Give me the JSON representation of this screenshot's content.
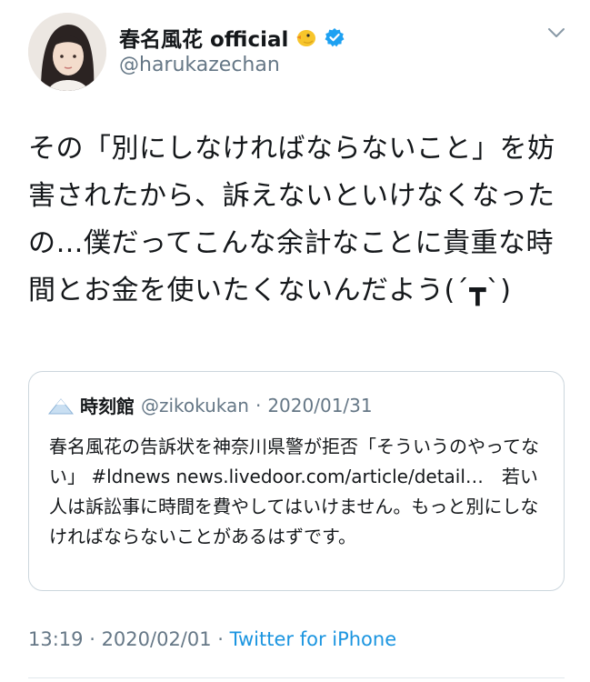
{
  "user": {
    "display_name": "春名風花 official",
    "handle": "@harukazechan"
  },
  "tweet": {
    "text": "その「別にしなければならないこと」を妨害されたから、訴えないといけなくなったの…僕だってこんな余計なことに貴重な時間とお金を使いたくないんだよう(´┳`)"
  },
  "quoted_tweet": {
    "name": "時刻館",
    "handle": "@zikokukan",
    "separator": "·",
    "date": "2020/01/31",
    "text": "春名風花の告訴状を神奈川県警が拒否「そういうのやってない」 #ldnews news.livedoor.com/article/detail…　若い人は訴訟事に時間を費やしてはいけません。もっと別にしなければならないことがあるはずです。"
  },
  "meta": {
    "time": "13:19",
    "separator1": " · ",
    "date": "2020/02/01",
    "separator2": " · ",
    "source": "Twitter for iPhone"
  },
  "colors": {
    "verified": "#1da1f2",
    "link": "#1b95e0",
    "secondary_text": "#657786",
    "border": "#ccd6dd"
  },
  "icons": {
    "verified": "verified-badge-icon",
    "emoji": "chick-emoji-icon",
    "menu": "chevron-down-icon"
  }
}
